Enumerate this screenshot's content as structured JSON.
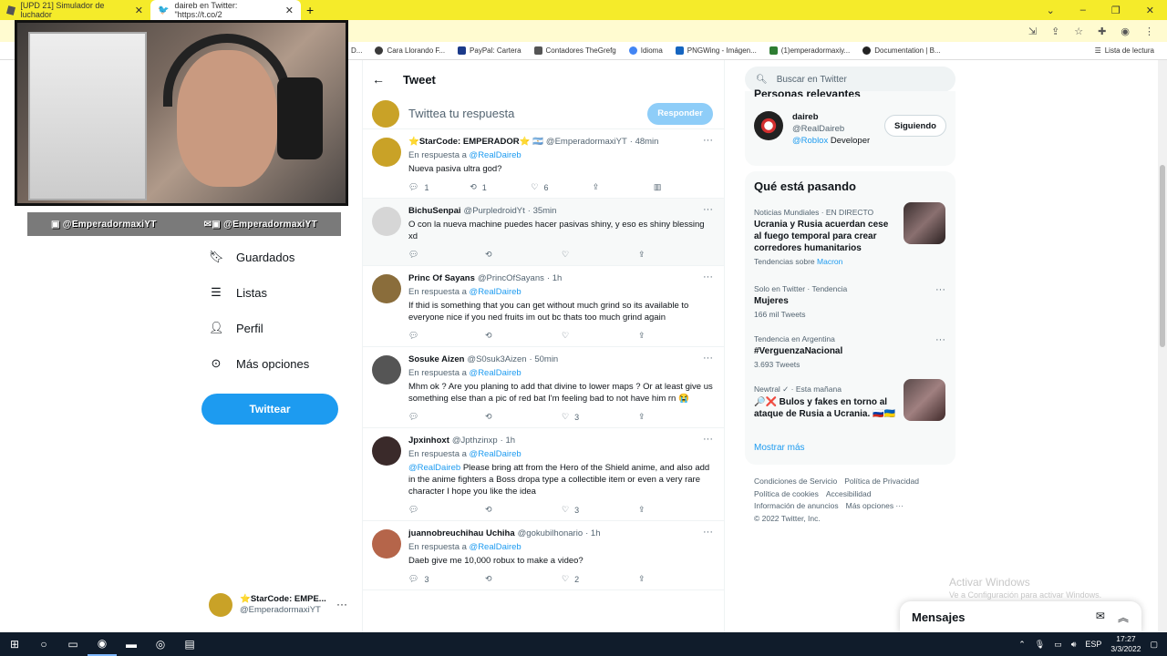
{
  "browser": {
    "tabs": [
      {
        "title": "[UPD 21] Simulador de luchador",
        "active": false
      },
      {
        "title": "daireb en Twitter: \"https://t.co/2",
        "active": true
      }
    ],
    "bookmarks": [
      "D...",
      "Cara Llorando F...",
      "PayPal: Cartera",
      "Contadores TheGrefg",
      "Idioma",
      "PNGWing - Imágen...",
      "(1)emperadormaxiy...",
      "Documentation | B..."
    ],
    "reading_list": "Lista de lectura"
  },
  "stream_overlay": {
    "handle_1": "@EmperadormaxiYT",
    "handle_2": "@EmperadormaxiYT"
  },
  "left_nav": {
    "items": [
      {
        "label": "Guardados",
        "icon": "bookmark-icon"
      },
      {
        "label": "Listas",
        "icon": "list-icon"
      },
      {
        "label": "Perfil",
        "icon": "profile-icon"
      },
      {
        "label": "Más opciones",
        "icon": "more-options-icon"
      }
    ],
    "tweet_button": "Twittear",
    "account": {
      "name": "StarCode: EMPE...",
      "handle": "@EmperadormaxiYT",
      "star": "⭐"
    }
  },
  "main": {
    "header_title": "Tweet",
    "reply_placeholder": "Twittea tu respuesta",
    "reply_button": "Responder",
    "tweets": [
      {
        "name": "⭐StarCode: EMPERADOR⭐ 🇦🇷",
        "handle": "@EmperadormaxiYT",
        "time": "· 48min",
        "reply_prefix": "En respuesta a",
        "reply_to": "@RealDaireb",
        "mention": "",
        "text": "Nueva pasiva ultra god?",
        "replies": "1",
        "retweets": "1",
        "likes": "6",
        "avatar_color": "#c9a227",
        "highlight": false
      },
      {
        "name": "BichuSenpai",
        "handle": "@PurpledroidYt",
        "time": "· 35min",
        "reply_prefix": "",
        "reply_to": "",
        "mention": "",
        "text": "O con la nueva machine puedes hacer pasivas shiny, y eso es shiny blessing xd",
        "replies": "",
        "retweets": "",
        "likes": "",
        "avatar_color": "#d6d6d6",
        "highlight": true
      },
      {
        "name": "Princ Of Sayans",
        "handle": "@PrincOfSayans",
        "time": "· 1h",
        "reply_prefix": "En respuesta a",
        "reply_to": "@RealDaireb",
        "mention": "",
        "text": "If thid is something that you can get without much grind so its available to everyone nice if you ned fruits im out bc thats too much grind again",
        "replies": "",
        "retweets": "",
        "likes": "",
        "avatar_color": "#8a6d3b",
        "highlight": false
      },
      {
        "name": "Sosuke Aizen",
        "handle": "@S0suk3Aizen",
        "time": "· 50min",
        "reply_prefix": "En respuesta a",
        "reply_to": "@RealDaireb",
        "mention": "",
        "text": "Mhm ok ? Are you planing to add that divine to lower maps ? Or at least give us something else than a pic of red bat I'm feeling bad to not have him rn 😭",
        "replies": "",
        "retweets": "",
        "likes": "3",
        "avatar_color": "#555555",
        "highlight": false
      },
      {
        "name": "Jpxinhoxt",
        "handle": "@Jpthzinxp",
        "time": "· 1h",
        "reply_prefix": "En respuesta a",
        "reply_to": "@RealDaireb",
        "mention": "@RealDaireb",
        "text": "Please bring att from the Hero of the Shield anime, and also add in the anime fighters a Boss dropa type a collectible item or even a very rare character I hope you like the idea",
        "replies": "",
        "retweets": "",
        "likes": "3",
        "avatar_color": "#3a2a2a",
        "highlight": false
      },
      {
        "name": "juannobreuchihau Uchiha",
        "handle": "@gokubilhonario",
        "time": "· 1h",
        "reply_prefix": "En respuesta a",
        "reply_to": "@RealDaireb",
        "mention": "",
        "text": "Daeb give me 10,000 robux to make a video?",
        "replies": "3",
        "retweets": "",
        "likes": "2",
        "avatar_color": "#b5654a",
        "highlight": false
      }
    ]
  },
  "sidebar": {
    "search_placeholder": "Buscar en Twitter",
    "relevant_title": "Personas relevantes",
    "relevant_user": {
      "name": "daireb",
      "handle": "@RealDaireb",
      "bio_link": "@Roblox",
      "bio_rest": " Developer",
      "follow_label": "Siguiendo"
    },
    "trends_title": "Qué está pasando",
    "trends": [
      {
        "meta": "Noticias Mundiales · EN DIRECTO",
        "name": "Ucrania y Rusia acuerdan cese al fuego temporal para crear corredores humanitarios",
        "sub_prefix": "Tendencias sobre",
        "sub_link": "Macron",
        "has_image": true,
        "image_color": "#5a4040"
      },
      {
        "meta": "Solo en Twitter · Tendencia",
        "name": "Mujeres",
        "sub_prefix": "166 mil Tweets",
        "sub_link": "",
        "has_image": false
      },
      {
        "meta": "Tendencia en Argentina",
        "name": "#VerguenzaNacional",
        "sub_prefix": "3.693 Tweets",
        "sub_link": "",
        "has_image": false
      },
      {
        "meta": "Newtral ✓ · Esta mañana",
        "name": "🔎❌ Bulos y fakes en torno al ataque de Rusia a Ucrania. 🇷🇺🇺🇦",
        "sub_prefix": "",
        "sub_link": "",
        "has_image": true,
        "image_color": "#7a5a5a"
      }
    ],
    "show_more": "Mostrar más",
    "footer_links": [
      "Condiciones de Servicio",
      "Política de Privacidad",
      "Política de cookies",
      "Accesibilidad",
      "Información de anuncios",
      "Más opciones ···",
      "© 2022 Twitter, Inc."
    ]
  },
  "windows": {
    "activate_title": "Activar Windows",
    "activate_sub": "Ve a Configuración para activar Windows.",
    "messages": "Mensajes",
    "tray_lang": "ESP",
    "time": "17:27",
    "date": "3/3/2022"
  },
  "colors": {
    "accent": "#1d9bf0",
    "tabbar": "#f5eb2a",
    "taskbar": "#101c2b"
  }
}
